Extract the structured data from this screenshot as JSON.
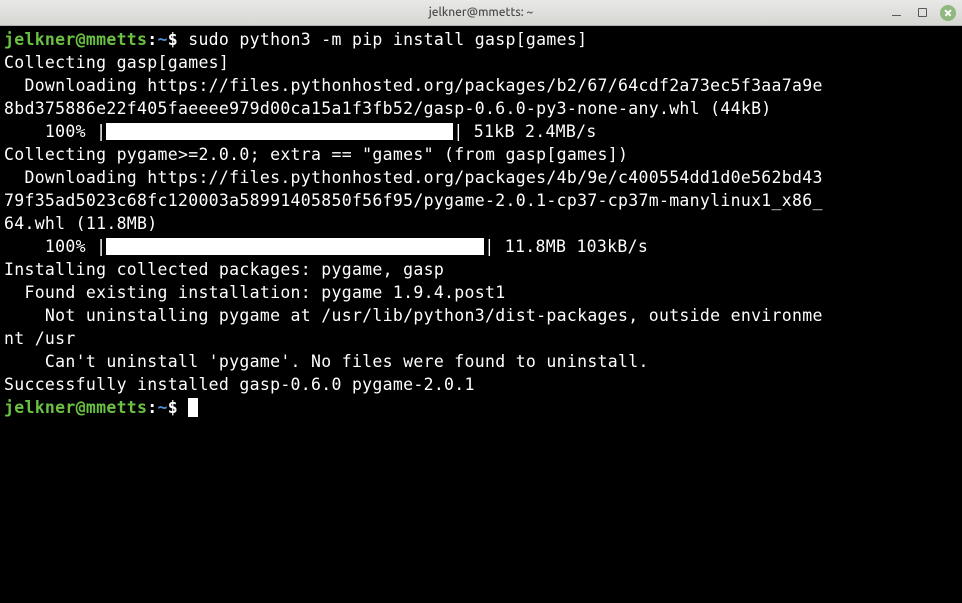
{
  "window": {
    "title": "jelkner@mmetts: ~"
  },
  "prompt": {
    "user_host": "jelkner@mmetts",
    "colon": ":",
    "path": "~",
    "dollar": "$"
  },
  "command": " sudo python3 -m pip install gasp[games]",
  "output": {
    "l1": "Collecting gasp[games]",
    "l2": "  Downloading https://files.pythonhosted.org/packages/b2/67/64cdf2a73ec5f3aa7a9e",
    "l3": "8bd375886e22f405faeeee979d00ca15a1f3fb52/gasp-0.6.0-py3-none-any.whl (44kB)",
    "l4_pre": "    100% |",
    "l4_post": "| 51kB 2.4MB/s ",
    "l5": "Collecting pygame>=2.0.0; extra == \"games\" (from gasp[games])",
    "l6": "  Downloading https://files.pythonhosted.org/packages/4b/9e/c400554dd1d0e562bd43",
    "l7": "79f35ad5023c68fc120003a58991405850f56f95/pygame-2.0.1-cp37-cp37m-manylinux1_x86_",
    "l8": "64.whl (11.8MB)",
    "l9_pre": "    100% |",
    "l9_post": "| 11.8MB 103kB/s ",
    "l10": "Installing collected packages: pygame, gasp",
    "l11": "  Found existing installation: pygame 1.9.4.post1",
    "l12": "    Not uninstalling pygame at /usr/lib/python3/dist-packages, outside environme",
    "l13": "nt /usr",
    "l14": "    Can't uninstall 'pygame'. No files were found to uninstall.",
    "l15": "Successfully installed gasp-0.6.0 pygame-2.0.1"
  }
}
